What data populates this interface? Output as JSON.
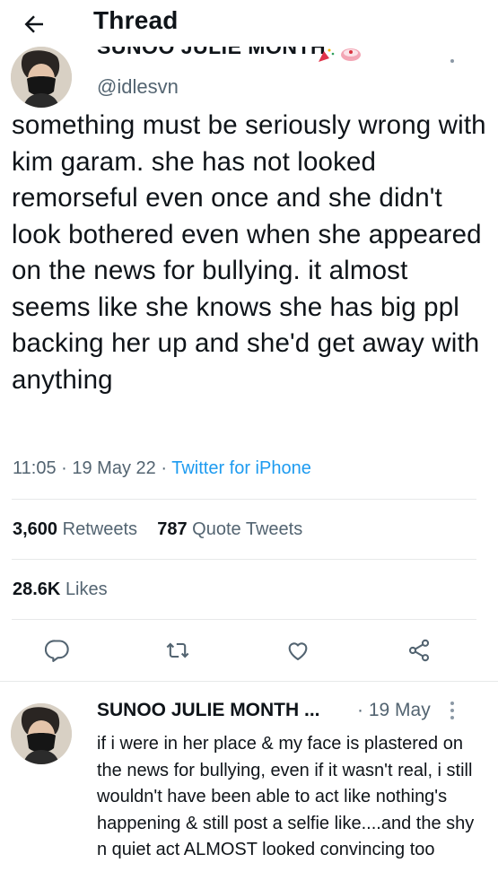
{
  "header": {
    "title": "Thread",
    "back_icon": "arrow-left-icon"
  },
  "tweet": {
    "author_name_cut": "SUNOO JULIE MONTH",
    "handle": "@idlesvn",
    "text": "something must be seriously wrong with kim garam. she has not looked remorseful even once and she didn't look bothered even when she appeared on the news for bullying. it almost seems like she knows she has big ppl backing her up and she'd get away with anything",
    "time": "11:05",
    "date": "19 May 22",
    "source": "Twitter for iPhone",
    "separator": "·",
    "retweets_count": "3,600",
    "retweets_label": "Retweets",
    "quotes_count": "787",
    "quotes_label": "Quote Tweets",
    "likes_count": "28.6K",
    "likes_label": "Likes"
  },
  "actions": [
    "reply-icon",
    "retweet-icon",
    "like-icon",
    "share-icon"
  ],
  "reply": {
    "author_name": "SUNOO JULIE MONTH ...",
    "date": "· 19 May",
    "text": "if i were in her place & my face is plastered on the news for bullying, even if it wasn't real, i still wouldn't have been able to act like nothing's happening & still post a selfie like....and the shy n quiet act ALMOST looked convincing too"
  },
  "colors": {
    "text_primary": "#0f1419",
    "text_secondary": "#536471",
    "accent": "#1d9bf0",
    "divider": "#e7e9ea"
  }
}
